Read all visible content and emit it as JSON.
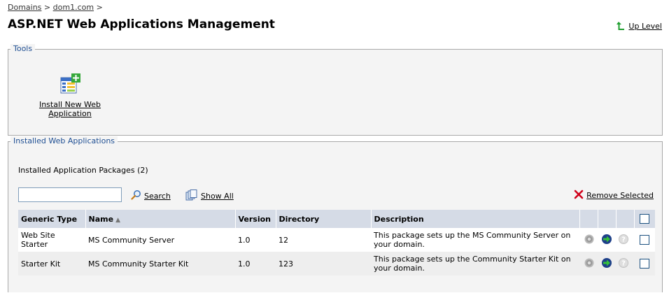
{
  "breadcrumb": {
    "domains": "Domains",
    "sep1": ">",
    "domain": "dom1.com",
    "sep2": ">"
  },
  "title": "ASP.NET Web Applications Management",
  "uplevel": {
    "label": "Up Level"
  },
  "tools": {
    "legend": "Tools",
    "install": {
      "label": "Install New Web Application"
    }
  },
  "installed": {
    "legend": "Installed Web Applications",
    "count_text": "Installed Application Packages (2)",
    "search": {
      "value": "",
      "label": "Search"
    },
    "show_all": "Show All",
    "remove_selected": "Remove Selected",
    "columns": [
      "Generic Type",
      "Name",
      "Version",
      "Directory",
      "Description"
    ],
    "rows": [
      {
        "type": "Web Site Starter",
        "name": "MS Community Server",
        "version": "1.0",
        "directory": "12",
        "description": "This package sets up the MS Community Server on your domain."
      },
      {
        "type": "Starter Kit",
        "name": "MS Community Starter Kit",
        "version": "1.0",
        "directory": "123",
        "description": "This package sets up the Community Starter Kit on your domain."
      }
    ]
  },
  "icons": {
    "uplevel": "green-up-arrow-icon",
    "install": "install-app-icon",
    "search": "magnifier-icon",
    "show_all": "show-all-icon",
    "remove": "red-x-icon",
    "settings": "gear-icon",
    "open": "go-arrow-icon",
    "help": "help-icon"
  },
  "colors": {
    "header_bg": "#d5dbe6",
    "legend_text": "#1f4f93",
    "panel_bg": "#f4f4f4",
    "remove_x": "#d0021b"
  }
}
